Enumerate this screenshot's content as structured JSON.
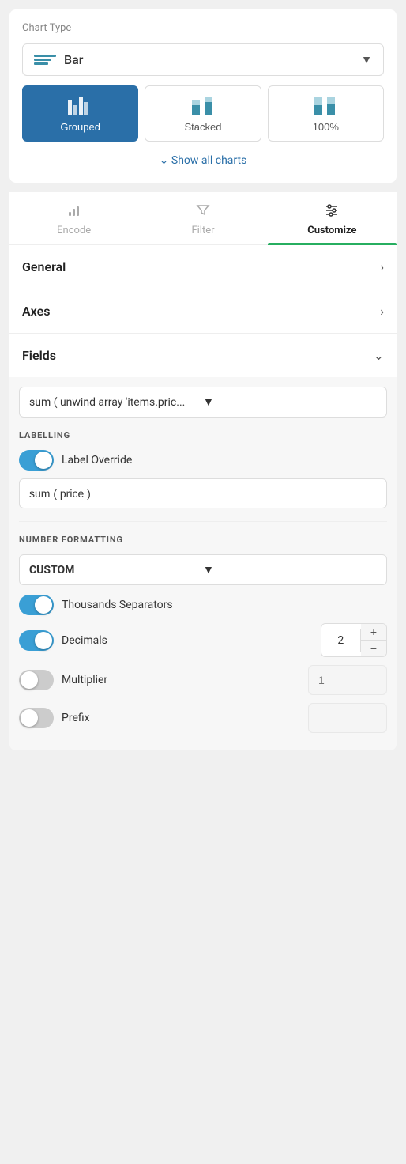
{
  "chartType": {
    "label": "Chart Type",
    "selected": "Bar",
    "variants": [
      {
        "id": "grouped",
        "label": "Grouped",
        "active": true
      },
      {
        "id": "stacked",
        "label": "Stacked",
        "active": false
      },
      {
        "id": "100pct",
        "label": "100%",
        "active": false
      }
    ],
    "showAllLabel": "Show all charts"
  },
  "tabs": [
    {
      "id": "encode",
      "label": "Encode",
      "active": false
    },
    {
      "id": "filter",
      "label": "Filter",
      "active": false
    },
    {
      "id": "customize",
      "label": "Customize",
      "active": true
    }
  ],
  "sections": {
    "general": {
      "label": "General"
    },
    "axes": {
      "label": "Axes"
    },
    "fields": {
      "label": "Fields",
      "selectedField": "sum ( unwind array 'items.pric..."
    }
  },
  "labelling": {
    "title": "LABELLING",
    "labelOverride": {
      "label": "Label Override",
      "enabled": true
    },
    "labelValue": "sum ( price )"
  },
  "numberFormatting": {
    "title": "NUMBER FORMATTING",
    "format": "CUSTOM",
    "thousandsSeparators": {
      "label": "Thousands Separators",
      "enabled": true
    },
    "decimals": {
      "label": "Decimals",
      "enabled": true,
      "value": "2"
    },
    "multiplier": {
      "label": "Multiplier",
      "enabled": false,
      "value": "1"
    },
    "prefix": {
      "label": "Prefix",
      "enabled": false,
      "value": ""
    }
  }
}
